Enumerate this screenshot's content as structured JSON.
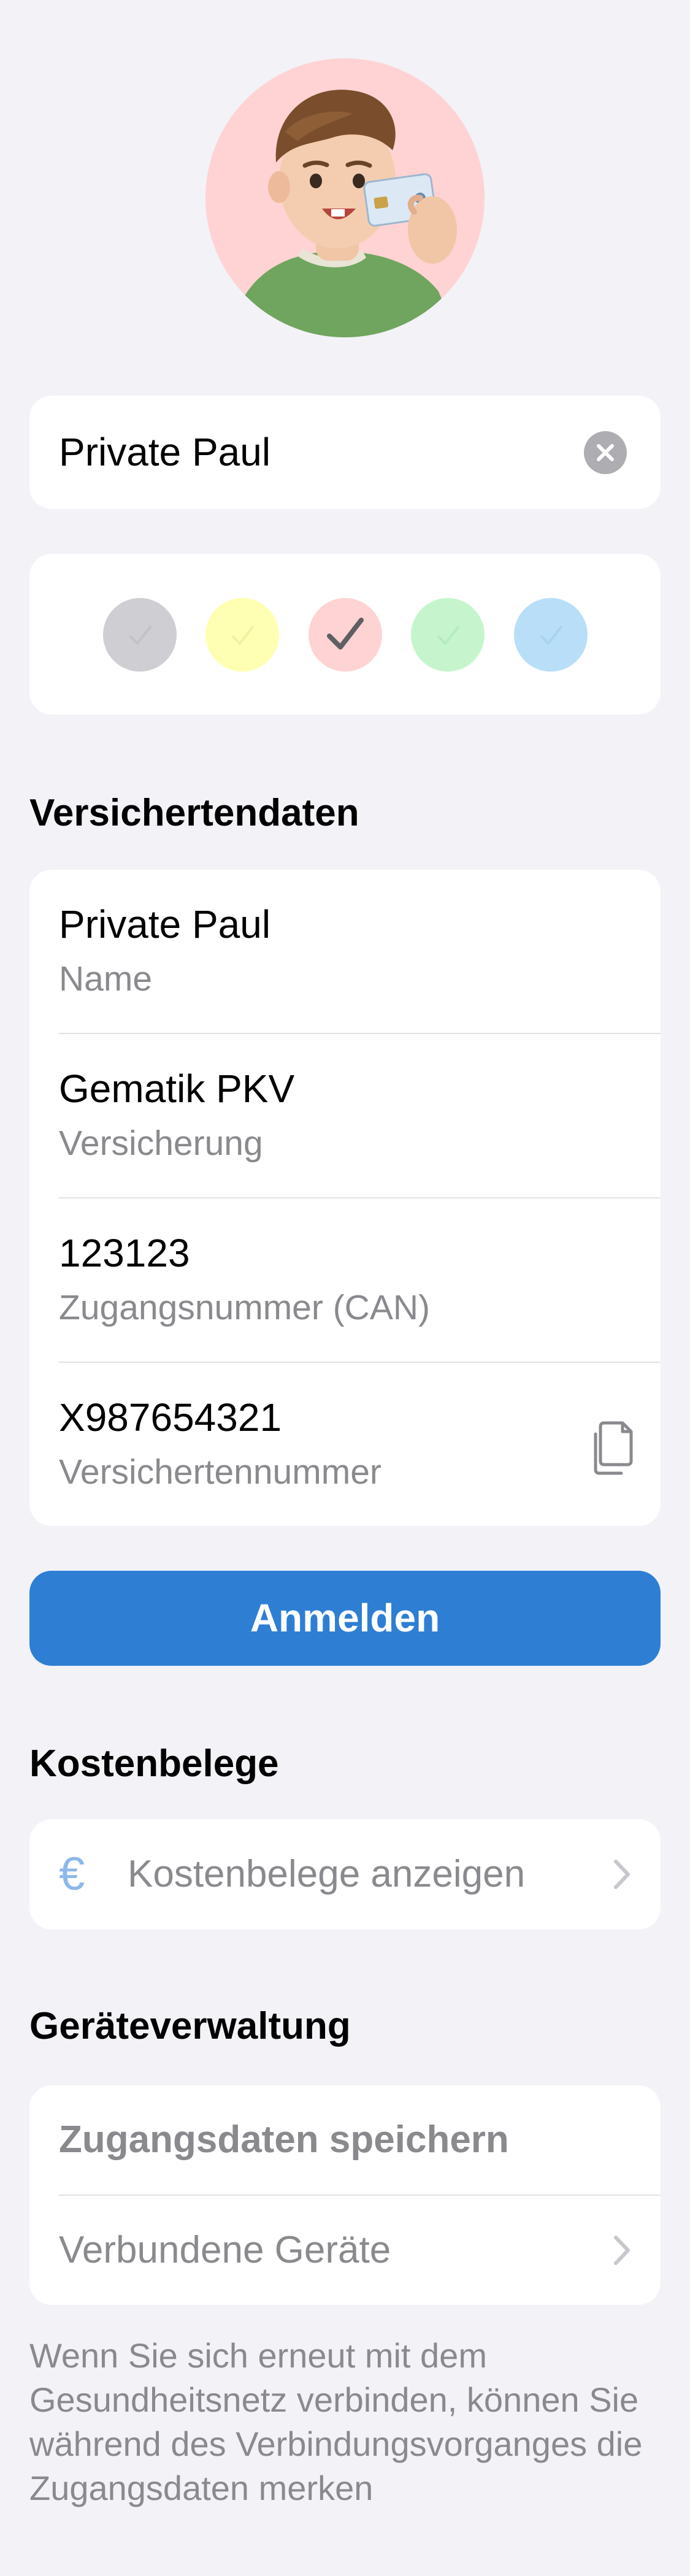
{
  "profile": {
    "name_value": "Private Paul",
    "avatar_icon": "boy-holding-health-card-avatar",
    "avatar_bg": "#FFD3D3",
    "clear_icon": "clear-icon"
  },
  "colors": {
    "options": [
      {
        "name": "gray",
        "hex": "#CFCFD3",
        "selected": false
      },
      {
        "name": "yellow",
        "hex": "#FFFFB3",
        "selected": false
      },
      {
        "name": "red",
        "hex": "#FFD3D3",
        "selected": true
      },
      {
        "name": "green",
        "hex": "#C6F5CD",
        "selected": false
      },
      {
        "name": "blue",
        "hex": "#B9DFF8",
        "selected": false
      }
    ]
  },
  "insured_data": {
    "title": "Versichertendaten",
    "rows": [
      {
        "value": "Private Paul",
        "label": "Name"
      },
      {
        "value": "Gematik PKV",
        "label": "Versicherung"
      },
      {
        "value": "123123",
        "label": "Zugangsnummer (CAN)"
      },
      {
        "value": "X987654321",
        "label": "Versichertennummer"
      }
    ],
    "copy_icon": "copy-icon"
  },
  "login_button": {
    "label": "Anmelden",
    "color": "#2E7FD4"
  },
  "receipts": {
    "title": "Kostenbelege",
    "symbol": "€",
    "show_label": "Kostenbelege anzeigen"
  },
  "devices": {
    "title": "Geräteverwaltung",
    "save_label": "Zugangsdaten speichern",
    "connected_label": "Verbundene Geräte",
    "footer": "Wenn Sie sich erneut mit dem Gesundheitsnetz verbinden, können Sie während des Verbindungsvorganges die Zugangsdaten merken"
  }
}
